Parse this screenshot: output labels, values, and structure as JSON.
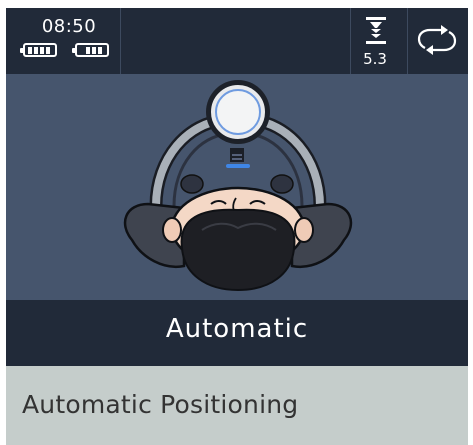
{
  "status": {
    "time": "08:50",
    "battery_levels": [
      1.0,
      0.75
    ],
    "height_icon": "table-height-icon",
    "height_value": "5.3",
    "sync_icon": "sync-arrows-icon"
  },
  "main": {
    "illustration": "patient-head-positioning",
    "mode_label": "Automatic",
    "description": "Automatic Positioning"
  },
  "colors": {
    "status_bar": "#212a39",
    "scene_bg": "#46556d",
    "desc_bg": "#c5cdcb",
    "sensor_ring": "#6f9be0",
    "sensor_led": "#3f86e6"
  }
}
